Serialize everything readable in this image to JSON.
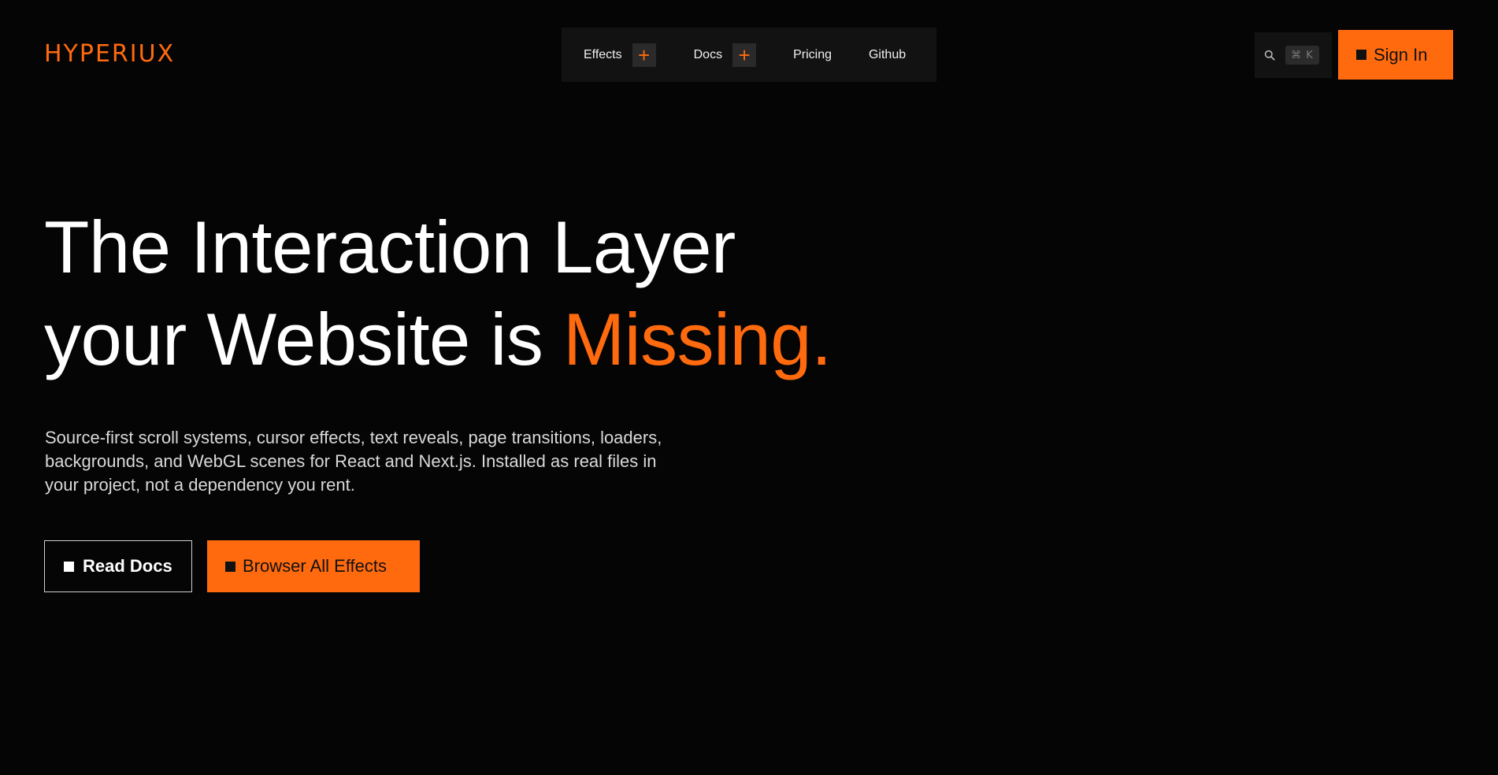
{
  "brand": {
    "logo_text": "HYPERIUX",
    "accent_color": "#ff6a0f",
    "background_color": "#050505"
  },
  "nav": {
    "items": [
      {
        "label": "Effects",
        "has_expand": true,
        "expand_icon": "plus-icon"
      },
      {
        "label": "Docs",
        "has_expand": true,
        "expand_icon": "plus-icon"
      },
      {
        "label": "Pricing",
        "has_expand": false
      },
      {
        "label": "Github",
        "has_expand": false
      }
    ]
  },
  "search": {
    "icon": "search-icon",
    "shortcut": "⌘ K"
  },
  "auth": {
    "sign_in_label": "Sign In"
  },
  "hero": {
    "title_line1": "The Interaction Layer",
    "title_line2_prefix": "your Website is ",
    "title_line2_accent": "Missing.",
    "description": "Source-first scroll systems, cursor effects, text reveals, page transitions, loaders, backgrounds, and WebGL scenes for React and Next.js. Installed as real files in your project, not a dependency you rent."
  },
  "cta": {
    "read_docs_label": "Read Docs",
    "browse_effects_label": "Browser All Effects"
  }
}
